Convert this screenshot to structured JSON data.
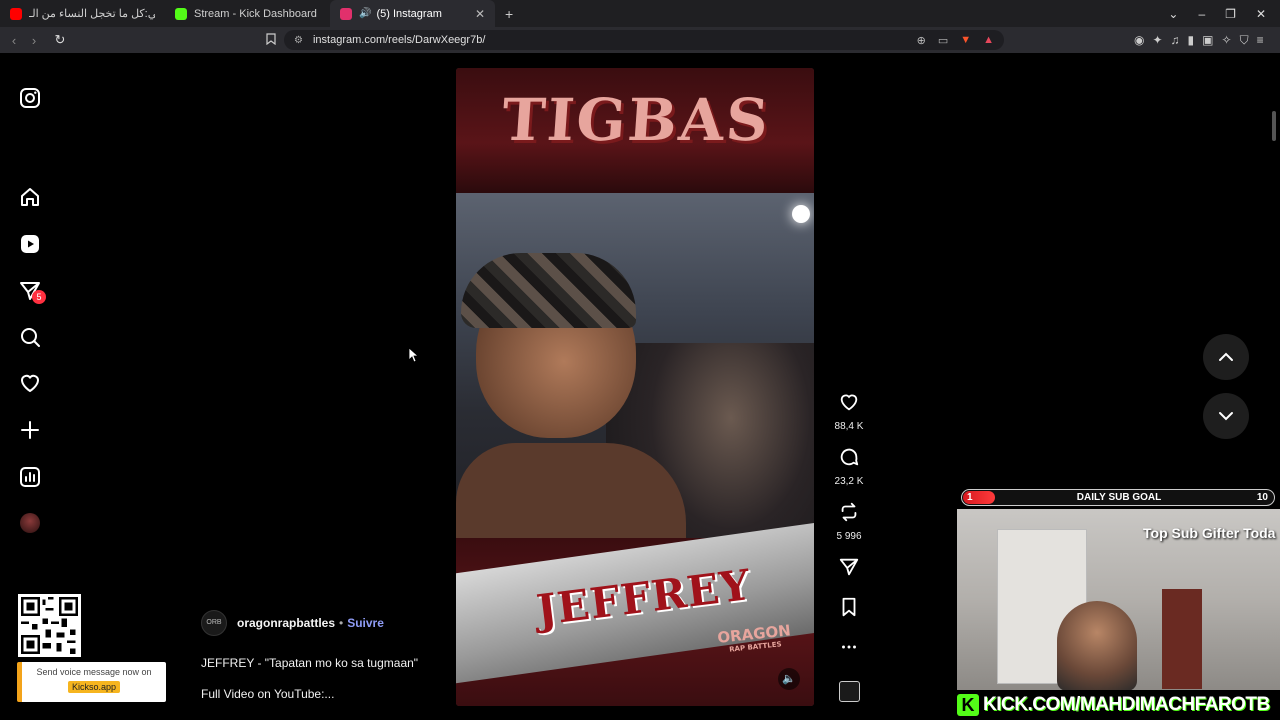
{
  "browser": {
    "tabs": [
      {
        "label": "أنس العويني:كل ما تخجل النساء من الـ...",
        "favicon_color": "#ff0000",
        "active": false
      },
      {
        "label": "Stream - Kick Dashboard",
        "favicon_color": "#53fc18",
        "active": false
      },
      {
        "label": "(5) Instagram",
        "favicon_color": "#e1306c",
        "active": true
      }
    ],
    "new_tab": "+",
    "url": "instagram.com/reels/DarwXeegr7b/"
  },
  "sidebar": {
    "notification_count": "5"
  },
  "qr_promo": {
    "line1": "Send voice message now on",
    "line2": "Kickso.app"
  },
  "reel": {
    "banner_text": "TIGBAS",
    "name_text": "JEFFREY",
    "brand_text": "ORAGON",
    "brand_sub": "RAP BATTLES",
    "username": "oragonrapbattles",
    "follow": "Suivre",
    "caption": "JEFFREY - \"Tapatan mo ko sa tugmaan\"",
    "more": "Full Video on YouTube:..."
  },
  "actions": {
    "likes": "88,4 K",
    "comments": "23,2 K",
    "reposts": "5 996"
  },
  "overlay": {
    "goal_current": "1",
    "goal_title": "DAILY SUB GOAL",
    "goal_total": "10",
    "gifter_text": "Top Sub Gifter Toda",
    "kick_url": "KICK.COM/MAHDIMACHFAROTB",
    "accent": "#53fc18"
  }
}
